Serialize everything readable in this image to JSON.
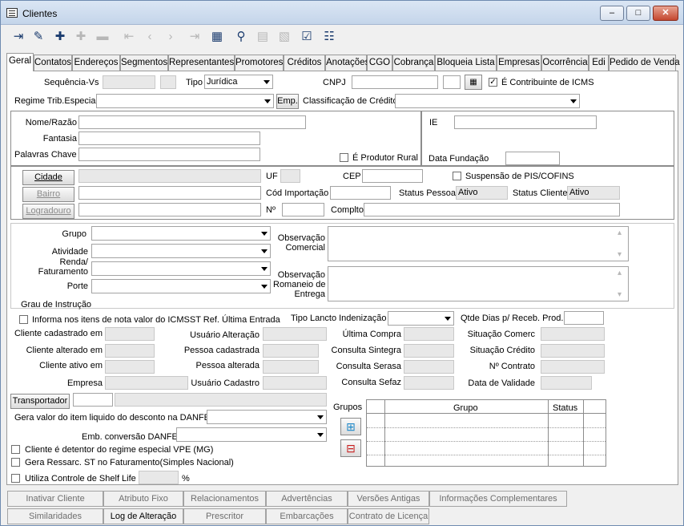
{
  "window": {
    "title": "Clientes",
    "min": "–",
    "max": "□",
    "close": "✕"
  },
  "toolbar": [
    {
      "name": "exit-icon",
      "glyph": "⇥",
      "enabled": true
    },
    {
      "name": "eraser-icon",
      "glyph": "✎",
      "enabled": true
    },
    {
      "name": "add-icon",
      "glyph": "✚",
      "enabled": true
    },
    {
      "name": "edit-icon",
      "glyph": "✚",
      "enabled": false
    },
    {
      "name": "delete-icon",
      "glyph": "▬",
      "enabled": false
    },
    {
      "name": "first-icon",
      "glyph": "⇤",
      "enabled": false
    },
    {
      "name": "prev-icon",
      "glyph": "‹",
      "enabled": false
    },
    {
      "name": "next-icon",
      "glyph": "›",
      "enabled": false
    },
    {
      "name": "last-icon",
      "glyph": "⇥",
      "enabled": false
    },
    {
      "name": "report-icon",
      "glyph": "▦",
      "enabled": true
    },
    {
      "name": "binoculars-icon",
      "glyph": "⚲",
      "enabled": true
    },
    {
      "name": "filter-icon",
      "glyph": "▤",
      "enabled": false
    },
    {
      "name": "export-icon",
      "glyph": "▧",
      "enabled": false
    },
    {
      "name": "checklist-icon",
      "glyph": "☑",
      "enabled": true
    },
    {
      "name": "tree-icon",
      "glyph": "☷",
      "enabled": true
    }
  ],
  "tabs": [
    "Geral",
    "Contatos",
    "Endereços",
    "Segmentos",
    "Representantes",
    "Promotores",
    "Créditos",
    "Anotações",
    "CGO",
    "Cobrança",
    "Bloqueia Lista",
    "Empresas",
    "Ocorrência",
    "Edi",
    "Pedido de Venda"
  ],
  "form": {
    "sequencia_label": "Sequência-Vs",
    "tipo_label": "Tipo",
    "tipo_value": "Jurídica",
    "cnpj_label": "CNPJ",
    "contribuinte_label": "É Contribuinte de ICMS",
    "contribuinte_checked": "✓",
    "regime_label": "Regime Trib.Especial",
    "emp_button": "Emp.",
    "classificacao_label": "Classificação de Crédito",
    "nome_label": "Nome/Razão",
    "fantasia_label": "Fantasia",
    "palavras_label": "Palavras Chave",
    "produtor_label": "É Produtor Rural",
    "ie_label": "IE",
    "data_fundacao_label": "Data Fundação",
    "cidade_button": "Cidade",
    "bairro_button": "Bairro",
    "logradouro_button": "Logradouro",
    "uf_label": "UF",
    "cep_label": "CEP",
    "suspensao_label": "Suspensão de PIS/COFINS",
    "cod_importacao_label": "Cód Importação",
    "status_pessoa_label": "Status Pessoa",
    "status_pessoa_value": "Ativo",
    "status_cliente_label": "Status Cliente",
    "status_cliente_value": "Ativo",
    "numero_label": "Nº",
    "complto_label": "Complto",
    "grupo_label": "Grupo",
    "atividade_label": "Atividade",
    "renda_label": "Renda/\nFaturamento",
    "porte_label": "Porte",
    "grau_label": "Grau de Instrução",
    "obs_comercial_label": "Observação\nComercial",
    "obs_romaneio_label": "Observação\nRomaneio de\nEntrega",
    "informa_label": "Informa nos itens de nota valor do ICMSST Ref. Última Entrada",
    "tipo_lancto_label": "Tipo Lancto Indenização",
    "qtde_dias_label": "Qtde Dias p/ Receb. Prod.",
    "cliente_cadastrado_label": "Cliente cadastrado em",
    "cliente_alterado_label": "Cliente alterado em",
    "cliente_ativo_label": "Cliente ativo em",
    "empresa_label": "Empresa",
    "usuario_alteracao_label": "Usuário Alteração",
    "pessoa_cadastrada_label": "Pessoa cadastrada",
    "pessoa_alterada_label": "Pessoa alterada",
    "usuario_cadastro_label": "Usuário Cadastro",
    "ultima_compra_label": "Última Compra",
    "consulta_sintegra_label": "Consulta Sintegra",
    "consulta_serasa_label": "Consulta Serasa",
    "consulta_sefaz_label": "Consulta Sefaz",
    "situacao_comerc_label": "Situação Comerc",
    "situacao_credito_label": "Situação Crédito",
    "n_contrato_label": "Nº Contrato",
    "data_validade_label": "Data de Validade",
    "transportador_button": "Transportador",
    "gera_valor_label": "Gera valor do item liquido do desconto na DANFE",
    "emb_conversao_label": "Emb. conversão DANFE",
    "vpe_label": "Cliente é detentor do regime especial VPE (MG)",
    "ressarc_label": "Gera Ressarc. ST no Faturamento(Simples Nacional)",
    "shelf_label": "Utiliza Controle de Shelf Life",
    "percent": "%",
    "grupos_label": "Grupos",
    "grid_col_grupo": "Grupo",
    "grid_col_status": "Status"
  },
  "bottom_row1": [
    "Inativar Cliente",
    "Atributo Fixo",
    "Relacionamentos",
    "Advertências",
    "Versões Antigas",
    "Informações Complementares"
  ],
  "bottom_row2": [
    "Similaridades",
    "Log de Alteração",
    "Prescritor",
    "Embarcações",
    "Contrato de Licença"
  ]
}
